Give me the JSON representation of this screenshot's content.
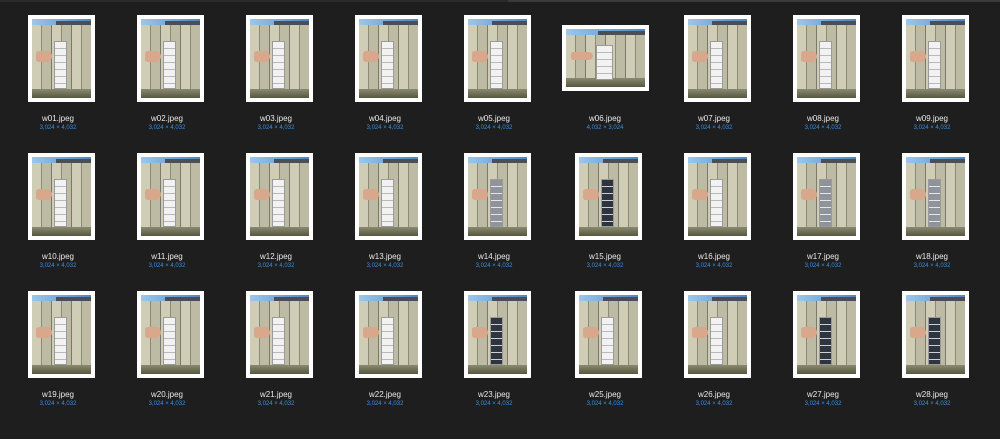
{
  "files": [
    {
      "name": "w01.jpeg",
      "dims": "3,024 × 4,032",
      "orientation": "portrait",
      "chart": "light"
    },
    {
      "name": "w02.jpeg",
      "dims": "3,024 × 4,032",
      "orientation": "portrait",
      "chart": "light"
    },
    {
      "name": "w03.jpeg",
      "dims": "3,024 × 4,032",
      "orientation": "portrait",
      "chart": "light"
    },
    {
      "name": "w04.jpeg",
      "dims": "3,024 × 4,032",
      "orientation": "portrait",
      "chart": "light"
    },
    {
      "name": "w05.jpeg",
      "dims": "3,024 × 4,032",
      "orientation": "portrait",
      "chart": "light"
    },
    {
      "name": "w06.jpeg",
      "dims": "4,032 × 3,024",
      "orientation": "landscape",
      "chart": "light"
    },
    {
      "name": "w07.jpeg",
      "dims": "3,024 × 4,032",
      "orientation": "portrait",
      "chart": "light"
    },
    {
      "name": "w08.jpeg",
      "dims": "3,024 × 4,032",
      "orientation": "portrait",
      "chart": "light"
    },
    {
      "name": "w09.jpeg",
      "dims": "3,024 × 4,032",
      "orientation": "portrait",
      "chart": "light"
    },
    {
      "name": "w10.jpeg",
      "dims": "3,024 × 4,032",
      "orientation": "portrait",
      "chart": "light"
    },
    {
      "name": "w11.jpeg",
      "dims": "3,024 × 4,032",
      "orientation": "portrait",
      "chart": "light"
    },
    {
      "name": "w12.jpeg",
      "dims": "3,024 × 4,032",
      "orientation": "portrait",
      "chart": "light"
    },
    {
      "name": "w13.jpeg",
      "dims": "3,024 × 4,032",
      "orientation": "portrait",
      "chart": "light"
    },
    {
      "name": "w14.jpeg",
      "dims": "3,024 × 4,032",
      "orientation": "portrait",
      "chart": "mid"
    },
    {
      "name": "w15.jpeg",
      "dims": "3,024 × 4,032",
      "orientation": "portrait",
      "chart": "dark"
    },
    {
      "name": "w16.jpeg",
      "dims": "3,024 × 4,032",
      "orientation": "portrait",
      "chart": "light"
    },
    {
      "name": "w17.jpeg",
      "dims": "3,024 × 4,032",
      "orientation": "portrait",
      "chart": "mid"
    },
    {
      "name": "w18.jpeg",
      "dims": "3,024 × 4,032",
      "orientation": "portrait",
      "chart": "mid"
    },
    {
      "name": "w19.jpeg",
      "dims": "3,024 × 4,032",
      "orientation": "portrait",
      "chart": "light"
    },
    {
      "name": "w20.jpeg",
      "dims": "3,024 × 4,032",
      "orientation": "portrait",
      "chart": "light"
    },
    {
      "name": "w21.jpeg",
      "dims": "3,024 × 4,032",
      "orientation": "portrait",
      "chart": "light"
    },
    {
      "name": "w22.jpeg",
      "dims": "3,024 × 4,032",
      "orientation": "portrait",
      "chart": "light"
    },
    {
      "name": "w23.jpeg",
      "dims": "3,024 × 4,032",
      "orientation": "portrait",
      "chart": "dark"
    },
    {
      "name": "w25.jpeg",
      "dims": "3,024 × 4,032",
      "orientation": "portrait",
      "chart": "light"
    },
    {
      "name": "w26.jpeg",
      "dims": "3,024 × 4,032",
      "orientation": "portrait",
      "chart": "light"
    },
    {
      "name": "w27.jpeg",
      "dims": "3,024 × 4,032",
      "orientation": "portrait",
      "chart": "dark"
    },
    {
      "name": "w28.jpeg",
      "dims": "3,024 × 4,032",
      "orientation": "portrait",
      "chart": "dark"
    }
  ],
  "colors": {
    "background": "#1e1e1e",
    "filename": "#e9e9e9",
    "dimensions": "#3c8fe0",
    "thumb_border": "#ffffff"
  }
}
